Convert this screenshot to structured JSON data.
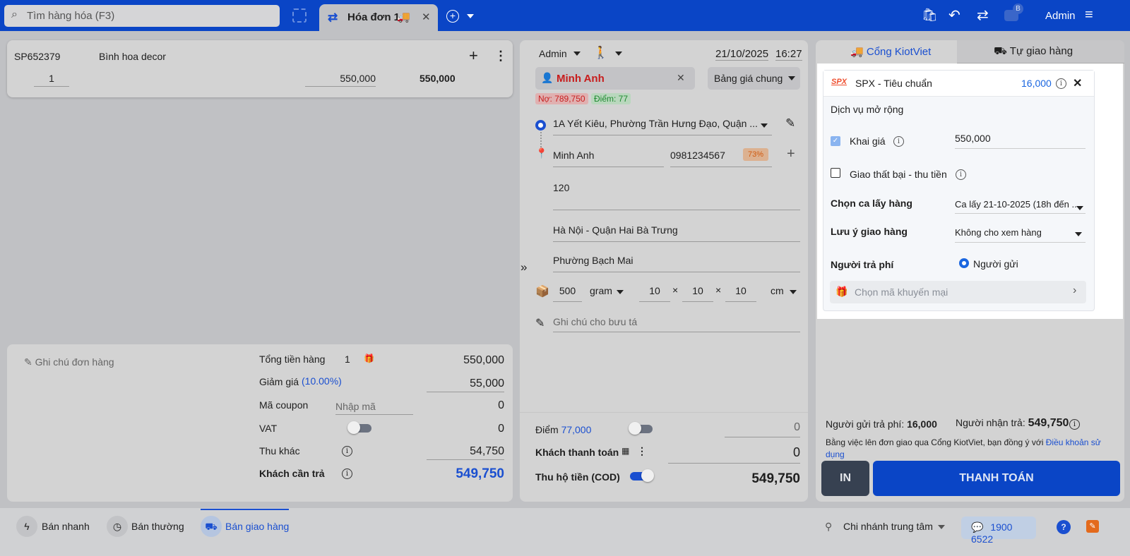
{
  "topbar": {
    "search_placeholder": "Tìm hàng hóa (F3)",
    "tab_label": "Hóa đơn 1",
    "user": "Admin",
    "notif_badge": "B"
  },
  "product": {
    "code": "SP652379",
    "name": "Bình hoa decor",
    "qty": "1",
    "price": "550,000",
    "total": "550,000"
  },
  "summary": {
    "note": "Ghi chú đơn hàng",
    "total_label": "Tổng tiền hàng",
    "total_qty": "1",
    "total_value": "550,000",
    "discount_label": "Giảm giá",
    "discount_pct": "(10.00%)",
    "discount_value": "55,000",
    "coupon_label": "Mã coupon",
    "coupon_placeholder": "Nhập mã",
    "coupon_value": "0",
    "vat_label": "VAT",
    "vat_value": "0",
    "other_label": "Thu khác",
    "other_value": "54,750",
    "due_label": "Khách cần trả",
    "due_value": "549,750"
  },
  "order": {
    "seller": "Admin",
    "date": "21/10/2025",
    "time": "16:27",
    "customer": "Minh Anh",
    "pricebook": "Bảng giá chung",
    "debt": "Nợ: 789,750",
    "points": "Điểm: 77",
    "from_address": "1A Yết Kiêu, Phường Trần Hưng Đạo, Quận ...",
    "receiver": "Minh Anh",
    "phone": "0981234567",
    "rate": "73%",
    "address": "120",
    "city": "Hà Nội - Quận Hai Bà Trưng",
    "ward": "Phường Bạch Mai",
    "weight": "500",
    "weight_unit": "gram",
    "l": "10",
    "w": "10",
    "h": "10",
    "dim_unit": "cm",
    "x": "×",
    "postman_note": "Ghi chú cho bưu tá",
    "points_label": "Điểm",
    "points_value": "77,000",
    "points_input": "0",
    "pay_label": "Khách thanh toán",
    "pay_value": "0",
    "cod_label": "Thu hộ tiền (COD)",
    "cod_value": "549,750"
  },
  "shipping": {
    "tab1": "Cổng KiotViet",
    "tab2": "Tự giao hàng",
    "logo": "SPX",
    "service": "SPX - Tiêu chuẩn",
    "fee": "16,000",
    "ext_label": "Dịch vụ mở rộng",
    "declare_label": "Khai giá",
    "declare_value": "550,000",
    "fail_label": "Giao thất bại - thu tiền",
    "pickup_label": "Chọn ca lấy hàng",
    "pickup_value": "Ca lấy 21-10-2025 (18h đến ...",
    "note_label": "Lưu ý giao hàng",
    "note_value": "Không cho xem hàng",
    "payer_label": "Người trả phí",
    "payer_value": "Người gửi",
    "promo": "Chọn mã khuyến mại",
    "sender_pays_label": "Người gửi trả phí:",
    "sender_pays": "16,000",
    "receiver_pays_label": "Người nhận trả:",
    "receiver_pays": "549,750",
    "terms": "Bằng việc lên đơn giao qua Cổng KiotViet, bạn đồng ý với",
    "terms_link": "Điều khoản sử dụng",
    "print": "IN",
    "pay": "THANH TOÁN"
  },
  "bottom": {
    "quick": "Bán nhanh",
    "normal": "Bán thường",
    "delivery": "Bán giao hàng",
    "branch": "Chi nhánh trung tâm",
    "hotline": "1900 6522"
  }
}
